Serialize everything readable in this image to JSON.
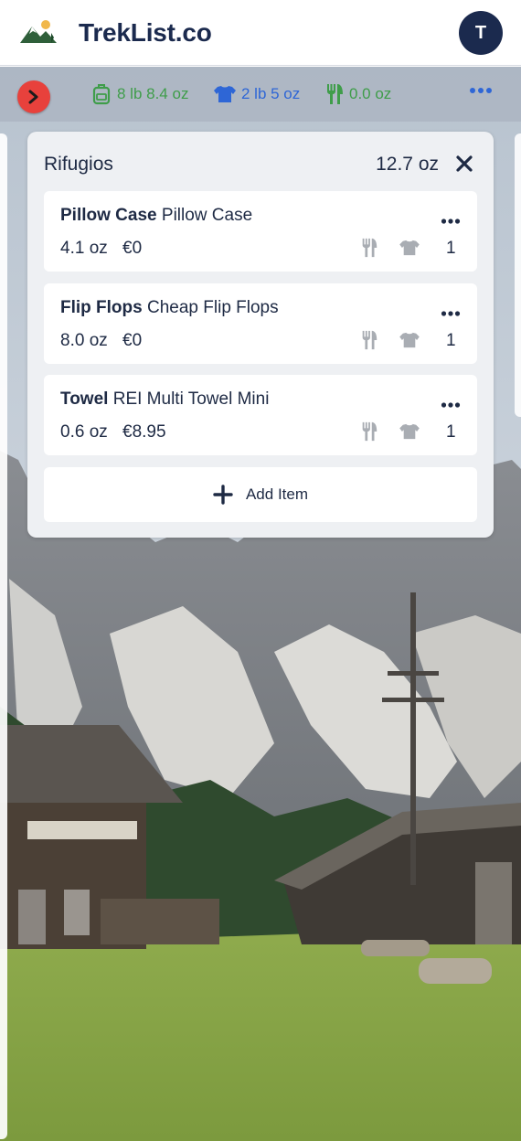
{
  "header": {
    "brand": "TrekList.co",
    "logo_icon": "mountain-logo-icon",
    "avatar_initial": "T"
  },
  "toolbar": {
    "expand_icon": "chevron-right-icon",
    "base_weight": "8 lb 8.4 oz",
    "worn_weight": "2 lb 5 oz",
    "consumable_weight": "0.0 oz",
    "more_icon": "more-horizontal-icon"
  },
  "list": {
    "title": "Rifugios",
    "total_weight": "12.7 oz",
    "items": [
      {
        "name": "Pillow Case",
        "description": "Pillow Case",
        "weight": "4.1 oz",
        "price": "€0",
        "qty": "1"
      },
      {
        "name": "Flip Flops",
        "description": "Cheap Flip Flops",
        "weight": "8.0 oz",
        "price": "€0",
        "qty": "1"
      },
      {
        "name": "Towel",
        "description": "REI Multi Towel Mini",
        "weight": "0.6 oz",
        "price": "€8.95",
        "qty": "1"
      }
    ],
    "add_label": "Add Item"
  },
  "colors": {
    "brand_navy": "#1b2a4e",
    "accent_red": "#e8413c",
    "base_green": "#3f9d4a",
    "worn_blue": "#2e66d6",
    "icon_gray": "#a9adb3"
  }
}
